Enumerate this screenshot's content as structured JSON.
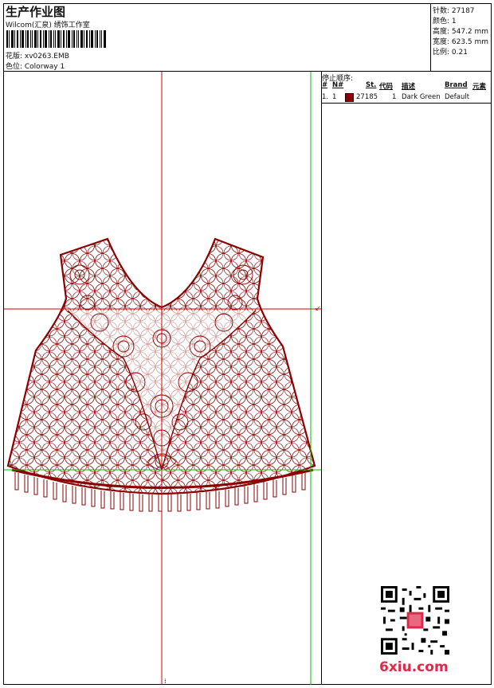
{
  "header": {
    "title": "生产作业图",
    "subtitle": "Wilcom(汇泉) 绣饰工作室",
    "design_label": "花版: xv0263.EMB",
    "colorway_label": "色位: Colorway 1"
  },
  "stats": {
    "stitches": "针数: 27187",
    "colors": "颜色: 1",
    "height": "高度: 547.2 mm",
    "width": "宽度: 623.5 mm",
    "scale": "比例: 0.21"
  },
  "stop_sequence": {
    "title": "停止顺序:",
    "headers": [
      "#",
      "N#",
      "St.",
      "代码",
      "描述",
      "Brand",
      "元素"
    ],
    "rows": [
      {
        "index": "1.",
        "needle": "1",
        "color_hex": "#8b0000",
        "stitches": "27185",
        "code": "1",
        "description": "Dark Green",
        "brand": "Default",
        "element": ""
      }
    ]
  },
  "colors": {
    "thread": "#8b0000",
    "guide_red": "#d00000",
    "guide_green": "#00c000",
    "watermark": "#e0284a"
  },
  "watermark": {
    "text": "6xiu.com"
  }
}
